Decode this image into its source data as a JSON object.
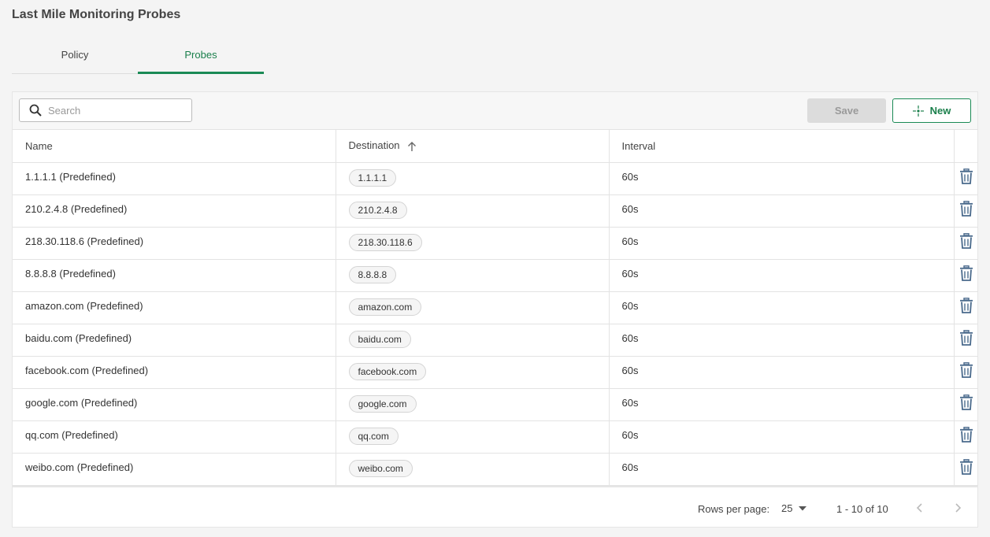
{
  "page": {
    "title": "Last Mile Monitoring Probes"
  },
  "tabs": [
    {
      "label": "Policy",
      "active": false
    },
    {
      "label": "Probes",
      "active": true
    }
  ],
  "toolbar": {
    "search_placeholder": "Search",
    "save_label": "Save",
    "new_label": "New"
  },
  "table": {
    "columns": {
      "name": "Name",
      "destination": "Destination",
      "interval": "Interval"
    },
    "sort": {
      "column": "Destination",
      "direction": "ascending"
    },
    "rows": [
      {
        "name": "1.1.1.1 (Predefined)",
        "destination": "1.1.1.1",
        "interval": "60s"
      },
      {
        "name": "210.2.4.8 (Predefined)",
        "destination": "210.2.4.8",
        "interval": "60s"
      },
      {
        "name": "218.30.118.6 (Predefined)",
        "destination": "218.30.118.6",
        "interval": "60s"
      },
      {
        "name": "8.8.8.8 (Predefined)",
        "destination": "8.8.8.8",
        "interval": "60s"
      },
      {
        "name": "amazon.com (Predefined)",
        "destination": "amazon.com",
        "interval": "60s"
      },
      {
        "name": "baidu.com (Predefined)",
        "destination": "baidu.com",
        "interval": "60s"
      },
      {
        "name": "facebook.com (Predefined)",
        "destination": "facebook.com",
        "interval": "60s"
      },
      {
        "name": "google.com (Predefined)",
        "destination": "google.com",
        "interval": "60s"
      },
      {
        "name": "qq.com (Predefined)",
        "destination": "qq.com",
        "interval": "60s"
      },
      {
        "name": "weibo.com (Predefined)",
        "destination": "weibo.com",
        "interval": "60s"
      }
    ]
  },
  "pagination": {
    "rows_per_page_label": "Rows per page:",
    "rows_per_page": "25",
    "range": "1 - 10 of 10"
  },
  "colors": {
    "accent": "#1a8a55",
    "icon": "#4a6a8c",
    "disabled_bg": "#dcdcdc"
  },
  "icons": {
    "search": "search-icon",
    "new": "crosshair-icon",
    "sort": "arrow-up-icon",
    "delete": "trash-icon",
    "dropdown": "caret-down-icon",
    "prev": "chevron-left-icon",
    "next": "chevron-right-icon"
  }
}
